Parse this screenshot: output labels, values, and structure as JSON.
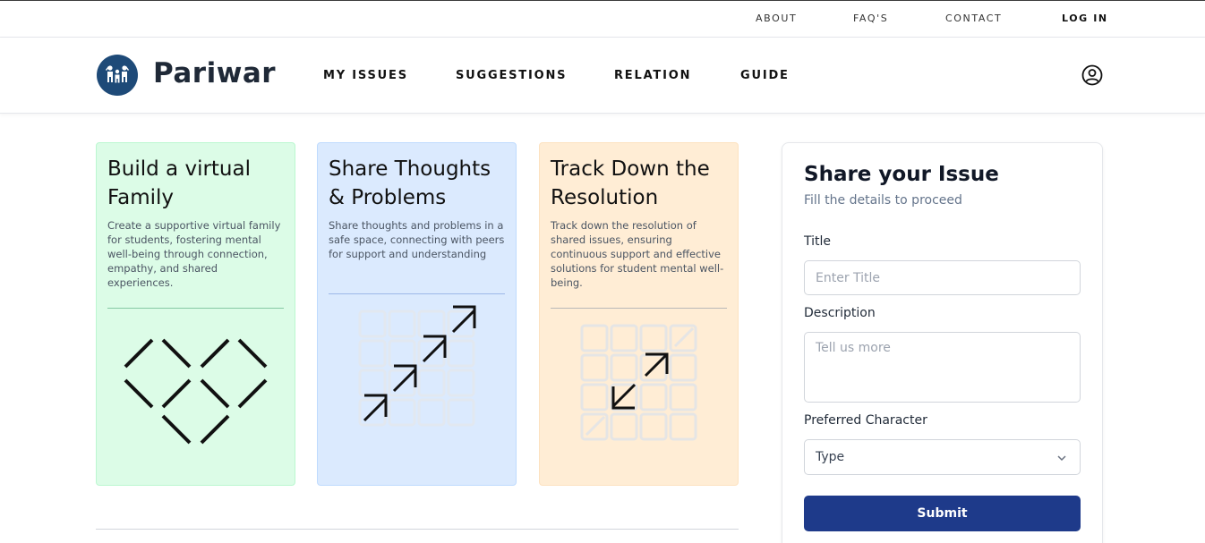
{
  "top_links": {
    "about": "ABOUT",
    "faqs": "FAQ'S",
    "contact": "CONTACT",
    "login": "LOG IN"
  },
  "brand": {
    "name": "Pariwar",
    "logo_icon": "family-icon"
  },
  "nav": {
    "my_issues": "MY ISSUES",
    "suggestions": "SUGGESTIONS",
    "relation": "RELATION",
    "guide": "GUIDE",
    "profile_icon": "user-circle-icon"
  },
  "cards": [
    {
      "title": "Build a virtual Family",
      "description": "Create a supportive virtual family for students, fostering mental well-being through connection, empathy, and shared experiences.",
      "color": "#dcfce7",
      "art_icon": "diamond-lattice-icon"
    },
    {
      "title": "Share Thoughts & Problems",
      "description": "Share thoughts and problems in a safe space, connecting with peers for support and understanding",
      "color": "#dbeafe",
      "art_icon": "diagonal-arrows-icon"
    },
    {
      "title": "Track Down the Resolution",
      "description": "Track down the resolution of shared issues, ensuring continuous support and effective solutions for student mental well-being.",
      "color": "#ffedd5",
      "art_icon": "opposing-arrows-icon"
    }
  ],
  "form": {
    "title": "Share your Issue",
    "subtitle": "Fill the details to proceed",
    "title_label": "Title",
    "title_placeholder": "Enter Title",
    "description_label": "Description",
    "description_placeholder": "Tell us more",
    "character_label": "Preferred Character",
    "character_value": "Type",
    "submit_label": "Submit",
    "accent_color": "#1e3a8a"
  }
}
